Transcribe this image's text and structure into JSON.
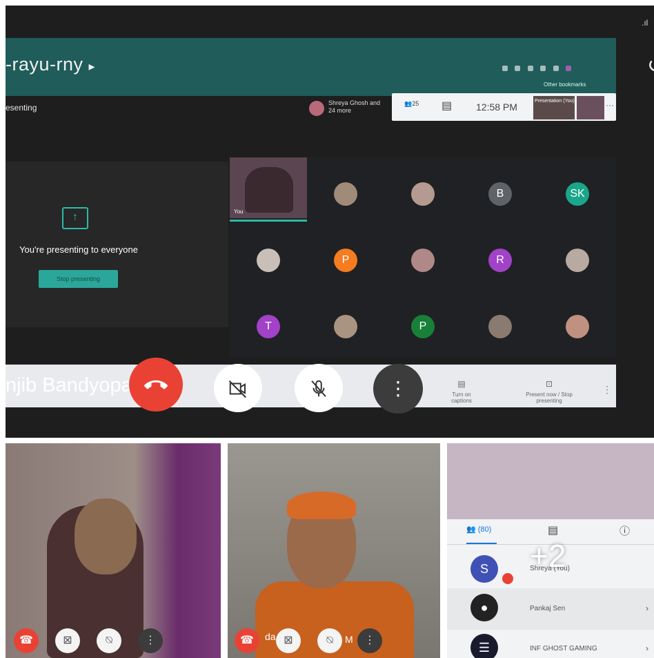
{
  "meeting": {
    "code": "-rayu-rny",
    "code_arrow": "▸",
    "bookmarks": "Other bookmarks",
    "presenting_label": "esenting",
    "host_text": "Shreya Ghosh and 24 more",
    "people_count": "25",
    "clock": "12:58 PM",
    "presentation_label": "Presentation (You)",
    "you_label": "You"
  },
  "presenting_panel": {
    "message": "You're presenting to everyone",
    "stop_button": "Stop presenting"
  },
  "grid": {
    "self_label": "You",
    "avatars": [
      {
        "initials": "",
        "color": "#a08a78"
      },
      {
        "initials": "",
        "color": "#b49a90"
      },
      {
        "initials": "B",
        "color": "#5f6368"
      },
      {
        "initials": "SK",
        "color": "#1aa68a"
      },
      {
        "initials": "",
        "color": "#c8c0b8"
      },
      {
        "initials": "P",
        "color": "#f57c1f"
      },
      {
        "initials": "",
        "color": "#b08888"
      },
      {
        "initials": "R",
        "color": "#a142c8"
      },
      {
        "initials": "",
        "color": "#b8aaa0"
      },
      {
        "initials": "T",
        "color": "#a142c8"
      },
      {
        "initials": "",
        "color": "#a89480"
      },
      {
        "initials": "P",
        "color": "#188038"
      },
      {
        "initials": "",
        "color": "#8a7a70"
      },
      {
        "initials": "",
        "color": "#c09080"
      }
    ]
  },
  "controls": {
    "name_overlay": "njib Bandyopa",
    "end_call_icon": "phone-hangup",
    "camera_icon": "video-off",
    "mic_icon": "mic-off",
    "more_icon": "⋮",
    "captions_label": "Turn on captions",
    "present_label": "Present now / Stop presenting"
  },
  "feeds": {
    "feed_2_name": "da S",
    "feed_2_name_end": "M"
  },
  "participants": {
    "people_tab": "(80)",
    "plus_more": "+2",
    "rows": [
      {
        "initial": "S",
        "name": "Shreya        (You)",
        "color": "#3f51b5"
      },
      {
        "initial": "●",
        "name": "Pankaj Sen",
        "color": "#222222"
      },
      {
        "initial": "☰",
        "name": "INF GHOST GAMING",
        "color": "#1a1a2e"
      }
    ]
  },
  "colors": {
    "accent": "#2bbba8",
    "end_call": "#e94235",
    "meet_blue": "#1a73e8"
  }
}
